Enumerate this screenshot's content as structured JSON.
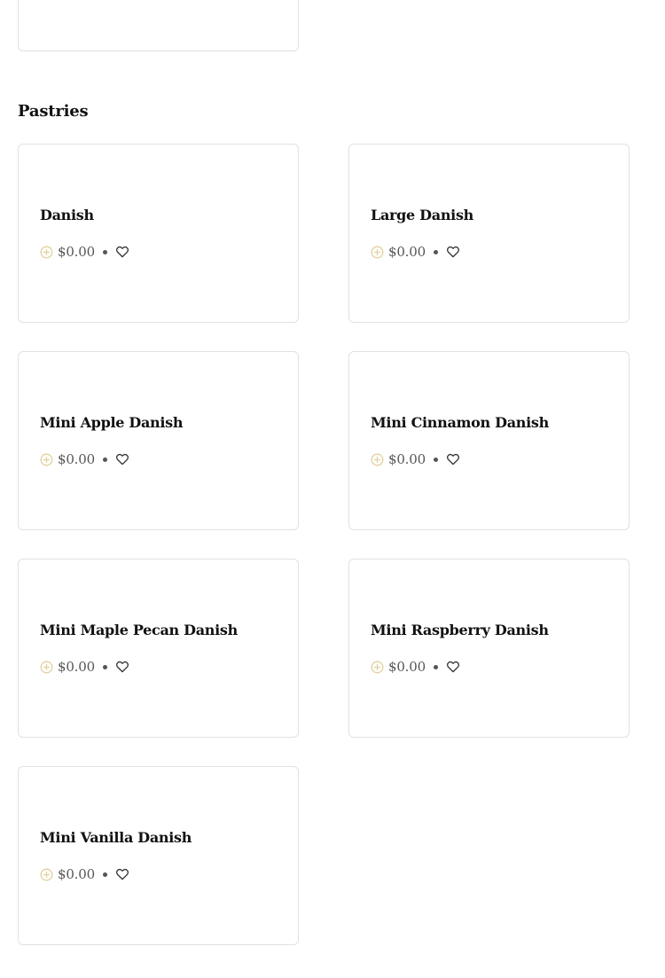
{
  "section": {
    "title": "Pastries"
  },
  "items": [
    {
      "name": "Danish",
      "price": "$0.00"
    },
    {
      "name": "Large Danish",
      "price": "$0.00"
    },
    {
      "name": "Mini Apple Danish",
      "price": "$0.00"
    },
    {
      "name": "Mini Cinnamon Danish",
      "price": "$0.00"
    },
    {
      "name": "Mini Maple Pecan Danish",
      "price": "$0.00"
    },
    {
      "name": "Mini Raspberry Danish",
      "price": "$0.00"
    },
    {
      "name": "Mini Vanilla Danish",
      "price": "$0.00"
    }
  ],
  "icons": {
    "add": "plus-circle-icon",
    "favorite": "heart-outline-icon"
  },
  "colors": {
    "add_icon": "#e3cf9c",
    "text_muted": "#555555",
    "card_border": "#e1e1e1"
  }
}
